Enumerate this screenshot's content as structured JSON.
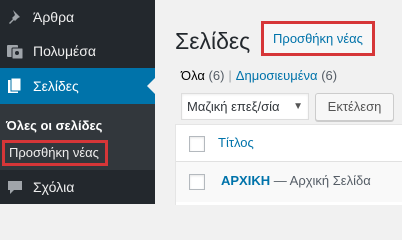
{
  "sidebar": {
    "items": [
      {
        "label": "Άρθρα",
        "icon": "pin-icon"
      },
      {
        "label": "Πολυμέσα",
        "icon": "media-icon"
      },
      {
        "label": "Σελίδες",
        "icon": "pages-icon"
      },
      {
        "label": "Σχόλια",
        "icon": "comment-icon"
      }
    ],
    "submenu": {
      "all_pages": "Όλες οι σελίδες",
      "add_new": "Προσθήκη νέας"
    },
    "active_color": "#0073aa",
    "highlight_color": "#d63638"
  },
  "main": {
    "title": "Σελίδες",
    "add_new_button": "Προσθήκη νέας",
    "filters": {
      "all_label": "Όλα",
      "all_count": "(6)",
      "separator": "|",
      "published_label": "Δημοσιευμένα",
      "published_count": "(6)"
    },
    "bulk_actions": {
      "selected": "Μαζική επεξ/σία"
    },
    "apply_button": "Εκτέλεση",
    "table": {
      "column_title": "Τίτλος",
      "rows": [
        {
          "title": "ΑΡΧΙΚΗ",
          "state": "— Αρχική Σελίδα"
        }
      ]
    }
  }
}
